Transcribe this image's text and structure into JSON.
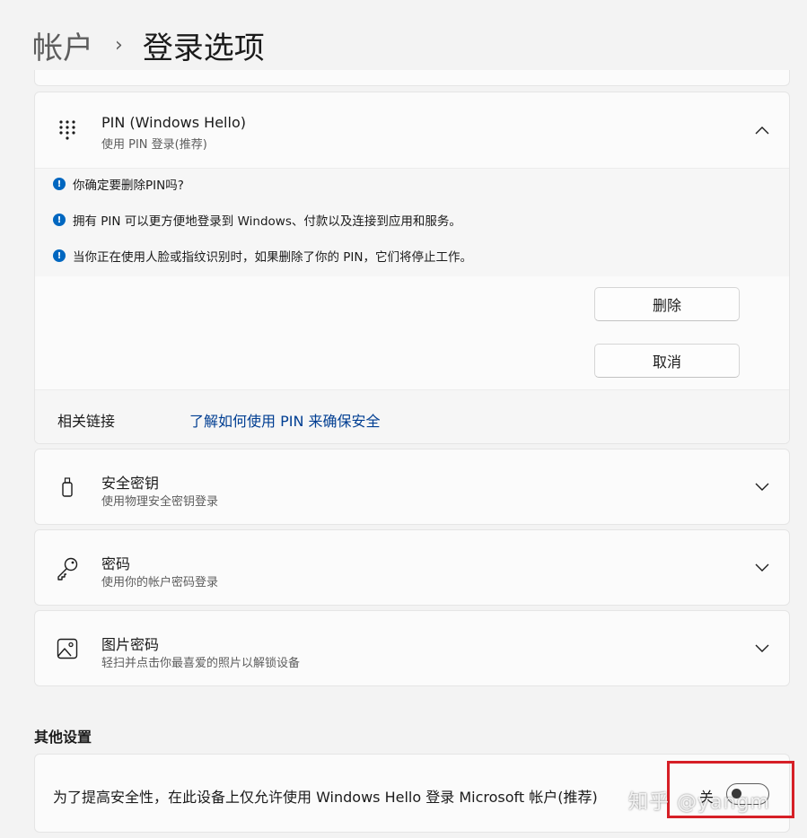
{
  "breadcrumb": {
    "parent": "帐户",
    "separator": "›",
    "current": "登录选项"
  },
  "pin": {
    "title": "PIN (Windows Hello)",
    "subtitle": "使用 PIN 登录(推荐)",
    "warnings": [
      "你确定要删除PIN吗?",
      "拥有 PIN 可以更方便地登录到 Windows、付款以及连接到应用和服务。",
      "当你正在使用人脸或指纹识别时，如果删除了你的 PIN，它们将停止工作。"
    ],
    "delete_label": "删除",
    "cancel_label": "取消",
    "related_label": "相关链接",
    "related_link": "了解如何使用 PIN 来确保安全"
  },
  "security_key": {
    "title": "安全密钥",
    "subtitle": "使用物理安全密钥登录"
  },
  "password": {
    "title": "密码",
    "subtitle": "使用你的帐户密码登录"
  },
  "picture_password": {
    "title": "图片密码",
    "subtitle": "轻扫并点击你最喜爱的照片以解锁设备"
  },
  "other": {
    "section_title": "其他设置",
    "setting_label": "为了提高安全性，在此设备上仅允许使用 Windows Hello 登录 Microsoft 帐户(推荐)",
    "toggle_state": "关",
    "toggle_on": false
  },
  "watermark": "知乎 @yangm",
  "colors": {
    "accent": "#0067c0",
    "link": "#003e92",
    "highlight": "#d61f26",
    "background": "#f3f3f3"
  }
}
